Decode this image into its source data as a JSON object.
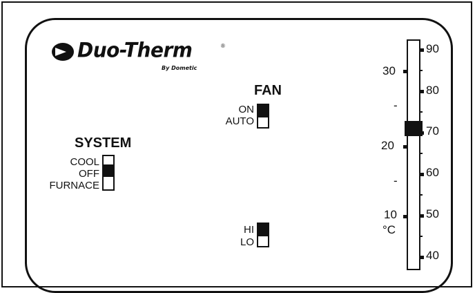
{
  "brand": {
    "name": "Duo-Therm",
    "registered": "®",
    "byline": "By Dometic"
  },
  "fan": {
    "title": "FAN",
    "mode_options": [
      "ON",
      "AUTO"
    ],
    "mode_selected": "ON",
    "speed_options": [
      "HI",
      "LO"
    ],
    "speed_selected": "HI"
  },
  "system": {
    "title": "SYSTEM",
    "options": [
      "COOL",
      "OFF",
      "FURNACE"
    ],
    "selected": "OFF"
  },
  "thermometer": {
    "celsius_labels": [
      "30",
      "-",
      "20",
      "-",
      "10"
    ],
    "celsius_unit": "°C",
    "fahrenheit_labels": [
      "90",
      "80",
      "70",
      "60",
      "50",
      "40"
    ],
    "set_temperature_f": 71
  },
  "colors": {
    "ink": "#111111",
    "background": "#ffffff"
  }
}
